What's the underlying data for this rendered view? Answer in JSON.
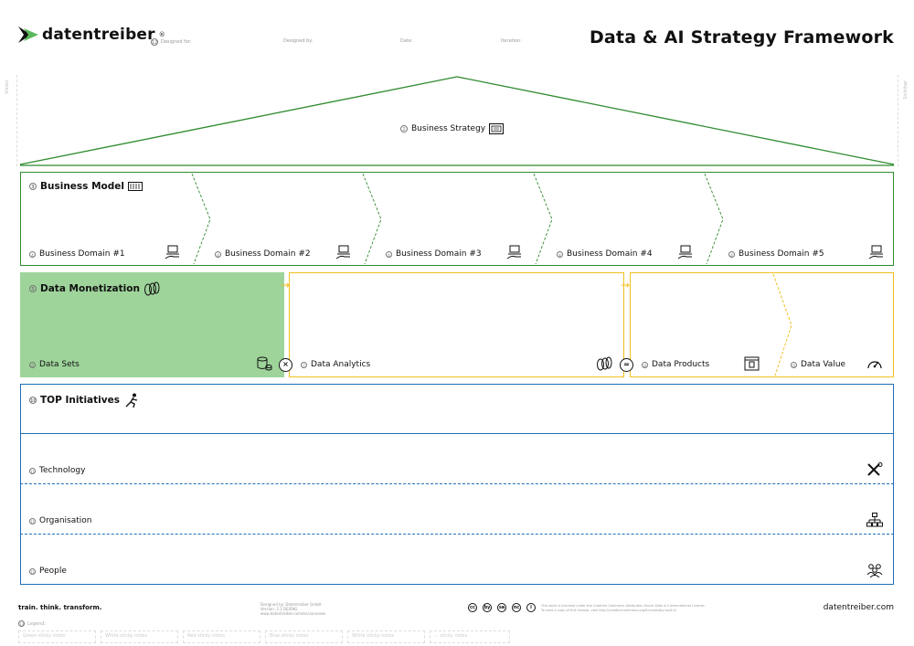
{
  "header": {
    "logo_text": "datentreiber",
    "logo_mark": "®",
    "title": "Data & AI Strategy Framework",
    "meta_fields": [
      {
        "num": "12",
        "label": "Designed for:"
      },
      {
        "num": "",
        "label": "Designed by:"
      },
      {
        "num": "",
        "label": "Date:"
      },
      {
        "num": "",
        "label": "Iteration:"
      }
    ]
  },
  "side": {
    "left": "Vision",
    "right": "Sichtbar"
  },
  "roof": {
    "num": "2",
    "label": "Business Strategy",
    "icon": "strategy-board-icon"
  },
  "business_model": {
    "num": "3",
    "label": "Business Model",
    "icon": "keyboard-icon",
    "domains": [
      {
        "num": "4",
        "label": "Business Domain #1"
      },
      {
        "num": "4",
        "label": "Business Domain #2"
      },
      {
        "num": "4",
        "label": "Business Domain #3"
      },
      {
        "num": "4",
        "label": "Business Domain #4"
      },
      {
        "num": "4",
        "label": "Business Domain #5"
      }
    ]
  },
  "data_monetization": {
    "num": "5",
    "label": "Data Monetization",
    "icon": "coins-icon",
    "segments": [
      {
        "num": "6",
        "label": "Data Sets",
        "icon": "database-coins-icon"
      },
      {
        "num": "7",
        "label": "Data Analytics",
        "icon": "coins-icon"
      },
      {
        "num": "8",
        "label": "Data Products",
        "icon": "product-icon"
      },
      {
        "num": "9",
        "label": "Data Value",
        "icon": "gauge-icon"
      }
    ],
    "operators": [
      "×",
      "="
    ],
    "arrow": "→"
  },
  "top_initiatives": {
    "num": "10",
    "label": "TOP Initiatives",
    "icon": "runner-icon",
    "rows": [
      {
        "num": "11",
        "label": "Technology",
        "icon": "tools-icon"
      },
      {
        "num": "11",
        "label": "Organisation",
        "icon": "org-chart-icon"
      },
      {
        "num": "11",
        "label": "People",
        "icon": "people-icon"
      }
    ]
  },
  "footer": {
    "tagline": "train. think. transform.",
    "designed_by": [
      "Designed by: Datentreiber GmbH",
      "Version: 2.1 DE/ENG",
      "www.datentreiber.com/en/canvases"
    ],
    "license": [
      "This work is licensed under the Creative Commons Attribution-Share Alike 4.0 International License.",
      "To view a copy of this license, visit http://creativecommons.org/licenses/by-sa/4.0/"
    ],
    "cc_icons": [
      "cc",
      "by",
      "sa",
      "nc",
      "i"
    ],
    "website": "datentreiber.com",
    "legend_num": "13",
    "legend_label": "Legend:",
    "legend_items": [
      "Green sticky notes",
      "White sticky notes",
      "Red sticky notes",
      "Blue sticky notes",
      "White sticky notes",
      "... sticky notes"
    ]
  },
  "colors": {
    "green": "#2e8b2e",
    "green_fill": "#9ed49a",
    "yellow": "#f0c020",
    "blue": "#1f6fb8"
  }
}
